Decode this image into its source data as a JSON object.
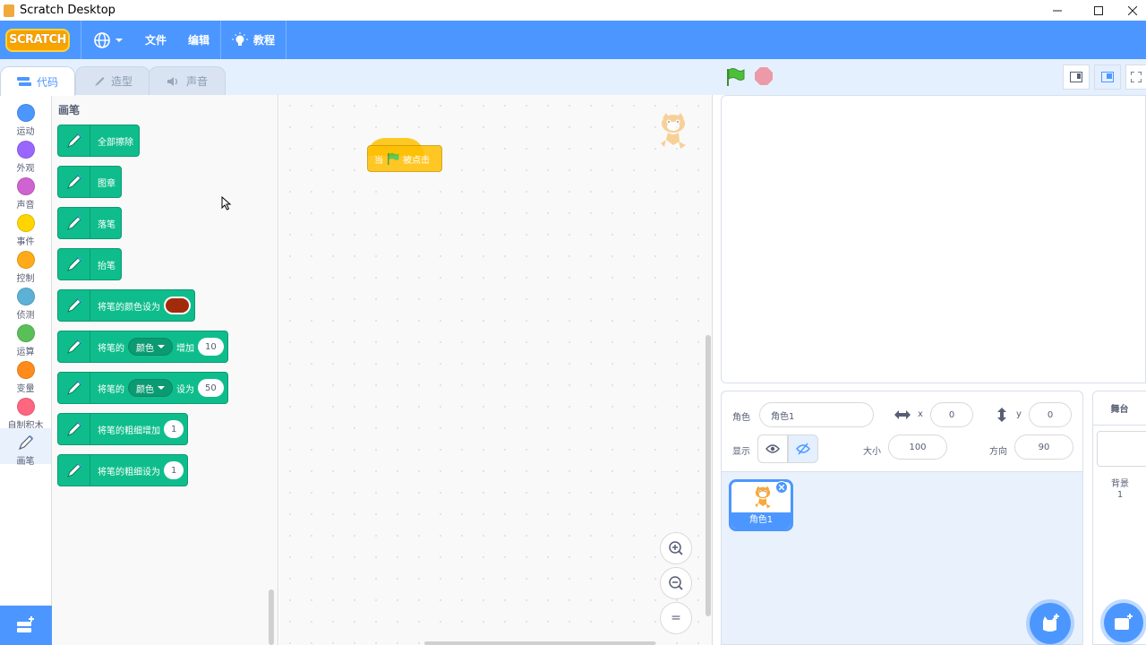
{
  "window": {
    "title": "Scratch Desktop"
  },
  "menubar": {
    "logo": "SCRATCH",
    "file": "文件",
    "edit": "编辑",
    "tutorials": "教程"
  },
  "tabs": {
    "code": "代码",
    "costumes": "造型",
    "sounds": "声音"
  },
  "categories": [
    {
      "label": "运动",
      "color": "#4c97ff"
    },
    {
      "label": "外观",
      "color": "#9966ff"
    },
    {
      "label": "声音",
      "color": "#cf63cf"
    },
    {
      "label": "事件",
      "color": "#ffd500"
    },
    {
      "label": "控制",
      "color": "#ffab19"
    },
    {
      "label": "侦测",
      "color": "#5cb1d6"
    },
    {
      "label": "运算",
      "color": "#59c059"
    },
    {
      "label": "变量",
      "color": "#ff8c1a"
    },
    {
      "label": "自制积木",
      "color": "#ff6680"
    },
    {
      "label": "画笔",
      "color": "#0fbd8c"
    }
  ],
  "palette": {
    "title": "画笔",
    "blocks": {
      "clear": "全部擦除",
      "stamp": "图章",
      "pen_down": "落笔",
      "pen_up": "抬笔",
      "set_color": "将笔的颜色设为",
      "change_param_prefix": "将笔的",
      "param_option": "颜色",
      "change_word": "增加",
      "change_value": "10",
      "set_word": "设为",
      "set_value": "50",
      "change_size": "将笔的粗细增加",
      "change_size_value": "1",
      "set_size": "将笔的粗细设为",
      "set_size_value": "1"
    }
  },
  "workspace": {
    "hat_prefix": "当",
    "hat_suffix": "被点击",
    "zoom_reset": "="
  },
  "sprite_info": {
    "sprite_label": "角色",
    "sprite_name": "角色1",
    "x_label": "x",
    "x_value": "0",
    "y_label": "y",
    "y_value": "0",
    "show_label": "显示",
    "size_label": "大小",
    "size_value": "100",
    "direction_label": "方向",
    "direction_value": "90"
  },
  "sprites": [
    {
      "name": "角色1"
    }
  ],
  "stage_pane": {
    "title": "舞台",
    "backdrops_label": "背景",
    "backdrops_count": "1"
  },
  "colors": {
    "accent": "#4c97ff",
    "pen": "#0fbd8c",
    "event": "#ffbf00",
    "pen_color_value": "#a22b0b"
  }
}
